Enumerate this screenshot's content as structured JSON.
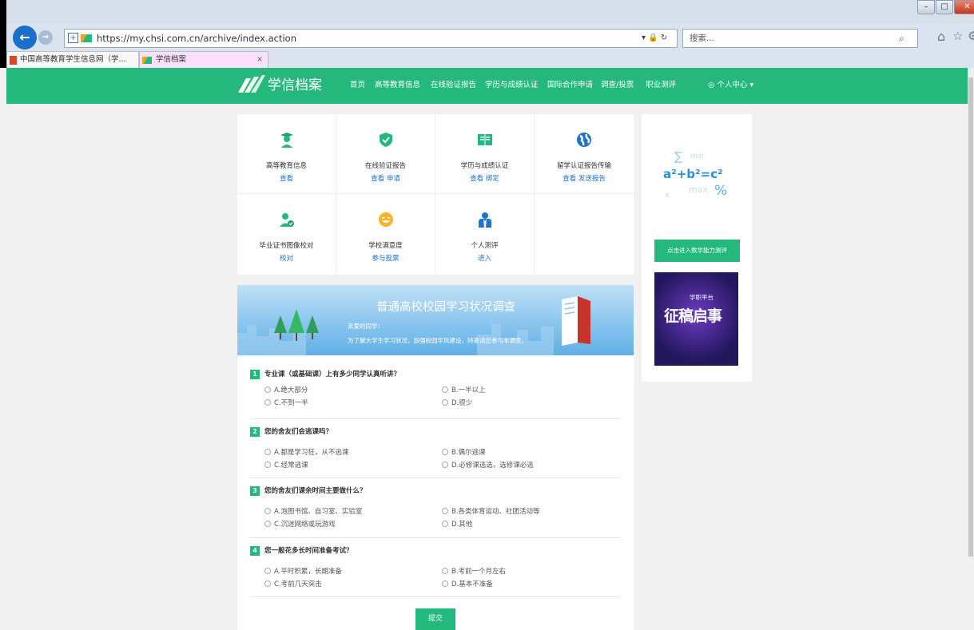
{
  "browser": {
    "url": "https://my.chsi.com.cn/archive/index.action",
    "search_placeholder": "搜索...",
    "tabs": [
      {
        "label": "中国高等教育学生信息网（学..."
      },
      {
        "label": "学信档案"
      }
    ],
    "tab_close": "×",
    "window_buttons": {
      "minimize": "–",
      "maximize": "□",
      "close": "✕"
    }
  },
  "site": {
    "logo_text": "学信档案",
    "nav": [
      "首页",
      "高等教育信息",
      "在线验证报告",
      "学历与成绩认证",
      "国际合作申请",
      "调查/投票",
      "职业测评"
    ],
    "user_menu": "个人中心",
    "user_menu_caret": "▾"
  },
  "services": [
    {
      "title": "高等教育信息",
      "links": [
        "查看"
      ]
    },
    {
      "title": "在线验证报告",
      "links": [
        "查看",
        "申请"
      ]
    },
    {
      "title": "学历与成绩认证",
      "links": [
        "查看",
        "绑定"
      ]
    },
    {
      "title": "留学认证报告传输",
      "links": [
        "查看",
        "发送报告"
      ]
    },
    {
      "title": "毕业证书图像校对",
      "links": [
        "校对"
      ]
    },
    {
      "title": "学校满意度",
      "links": [
        "参与投票"
      ]
    },
    {
      "title": "个人测评",
      "links": [
        "进入"
      ]
    }
  ],
  "sidebar": {
    "math_formula": "a²+b²=c²",
    "math_decor": [
      "∑",
      "min",
      "max",
      "%",
      "x"
    ],
    "math_button": "点击进入数学能力测评",
    "ad_small": "学职平台",
    "ad_big": "征稿启事"
  },
  "survey": {
    "title": "普通高校校园学习状况调查",
    "greeting": "亲爱的同学：",
    "intro": "为了解大学生学习状况，加强校园学风建设，特邀请您参与本调查。",
    "questions": [
      {
        "num": "1",
        "text": "专业课（或基础课）上有多少同学认真听讲？",
        "options": [
          "A.绝大部分",
          "B.一半以上",
          "C.不到一半",
          "D.很少"
        ]
      },
      {
        "num": "2",
        "text": "您的舍友们会逃课吗？",
        "options": [
          "A.都是学习狂，从不逃课",
          "B.偶尔逃课",
          "C.经常逃课",
          "D.必修课逃选，选修课必逃"
        ]
      },
      {
        "num": "3",
        "text": "您的舍友们课余时间主要做什么？",
        "options": [
          "A.泡图书馆、自习室、实验室",
          "B.各类体育运动、社团活动等",
          "C.沉迷网络或玩游戏",
          "D.其他"
        ]
      },
      {
        "num": "4",
        "text": "您一般花多长时间准备考试？",
        "options": [
          "A.平时积累，长期准备",
          "B.考前一个月左右",
          "C.考前几天突击",
          "D.基本不准备"
        ]
      }
    ],
    "submit": "提交"
  },
  "colors": {
    "brand_green": "#25b87c",
    "link_blue": "#1f73c9",
    "banner_blue": "#5fafe6"
  }
}
